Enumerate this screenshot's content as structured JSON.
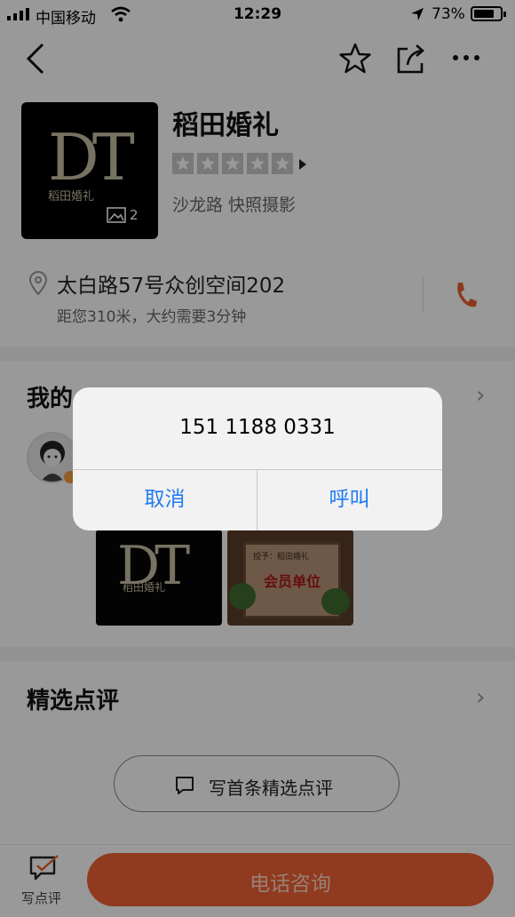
{
  "status_bar": {
    "carrier": "中国移动",
    "time": "12:29",
    "battery": "73%"
  },
  "header": {
    "icons": [
      "back-icon",
      "star-icon",
      "share-icon",
      "more-icon"
    ]
  },
  "shop": {
    "name": "稻田婚礼",
    "logo_text": "DT",
    "logo_cn": "稻田婚礼",
    "photo_count": "2",
    "rating_stars": 5,
    "tags": "沙龙路 快照摄影",
    "address": "太白路57号众创空间202",
    "distance": "距您310米，大约需要3分钟"
  },
  "my_section": {
    "title": "我的"
  },
  "photos": {
    "plaque_small": "授予：稻田婚礼",
    "plaque_big": "会员单位"
  },
  "reviews": {
    "title": "精选点评",
    "write_first": "写首条精选点评"
  },
  "bottom": {
    "write_review": "写点评",
    "call": "电话咨询"
  },
  "dialog": {
    "phone": "151 1188 0331",
    "cancel": "取消",
    "call": "呼叫"
  },
  "colors": {
    "accent": "#f06234",
    "ios_blue": "#1f7bf0",
    "phone_icon": "#e8602f"
  }
}
